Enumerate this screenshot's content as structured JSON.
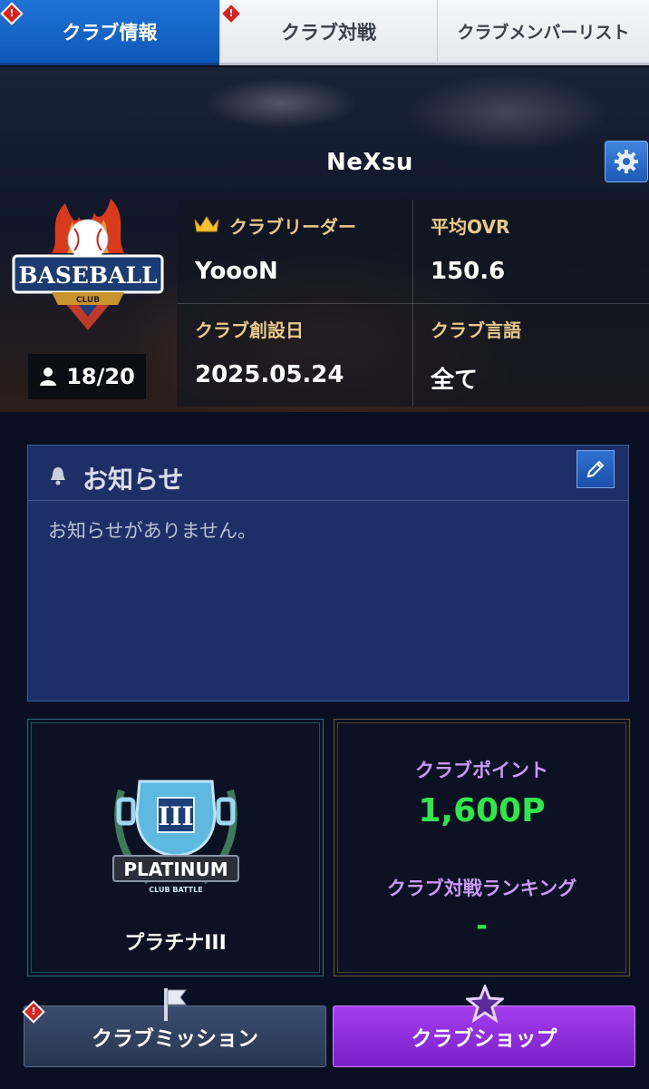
{
  "tabs": [
    {
      "label": "クラブ情報",
      "active": true
    },
    {
      "label": "クラブ対戦",
      "active": false
    },
    {
      "label": "クラブメンバーリスト",
      "active": false
    }
  ],
  "alert_mark": "!",
  "club": {
    "name": "NeXsu",
    "emblem_text": "BASEBALL",
    "emblem_sub": "CLUB",
    "members": "18/20",
    "info": {
      "leader_label": "クラブリーダー",
      "leader_value": "YoooN",
      "avg_ovr_label": "平均OVR",
      "avg_ovr_value": "150.6",
      "founded_label": "クラブ創設日",
      "founded_value": "2025.05.24",
      "language_label": "クラブ言語",
      "language_value": "全て"
    }
  },
  "notice": {
    "title": "お知らせ",
    "body": "お知らせがありません。"
  },
  "rank": {
    "badge_numeral": "III",
    "badge_title": "PLATINUM",
    "badge_sub": "CLUB BATTLE",
    "name": "プラチナIII"
  },
  "points": {
    "points_label": "クラブポイント",
    "points_value": "1,600P",
    "ranking_label": "クラブ対戦ランキング",
    "ranking_value": "-"
  },
  "buttons": {
    "mission": "クラブミッション",
    "shop": "クラブショップ"
  },
  "colors": {
    "tab_active": "#1e73d6",
    "notice_bg": "#1d2f66",
    "label_gold": "#e8c98a",
    "points_green": "#30e64a",
    "points_label_purple": "#c99af5",
    "shop_purple": "#a43ef0"
  }
}
